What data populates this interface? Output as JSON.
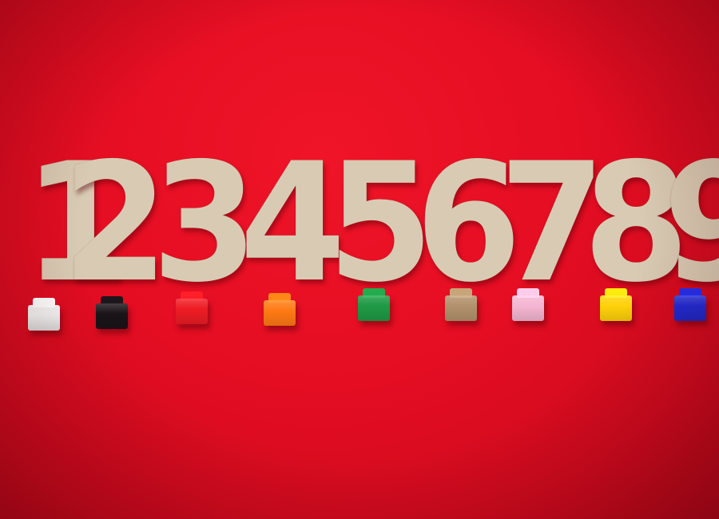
{
  "photo": {
    "background_color": "#e40d22",
    "digit_color": "#d9cbb3",
    "digits": [
      "1",
      "2",
      "3",
      "4",
      "5",
      "6",
      "7",
      "8",
      "9"
    ],
    "block_colors": [
      {
        "name": "white",
        "hex": "#f2f2f2"
      },
      {
        "name": "black",
        "hex": "#1a1418"
      },
      {
        "name": "red",
        "hex": "#ee1c24"
      },
      {
        "name": "orange",
        "hex": "#ff7a14"
      },
      {
        "name": "green",
        "hex": "#1f9a45"
      },
      {
        "name": "tan",
        "hex": "#b3926d"
      },
      {
        "name": "pink",
        "hex": "#f4b6d2"
      },
      {
        "name": "yellow",
        "hex": "#ffd20a"
      },
      {
        "name": "blue",
        "hex": "#1f2bd8"
      }
    ]
  }
}
